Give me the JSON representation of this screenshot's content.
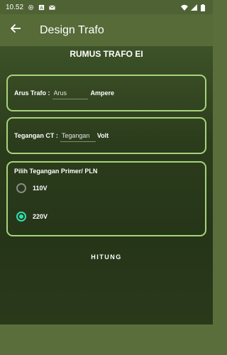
{
  "status_bar": {
    "time": "10.52",
    "icons": [
      "settings-icon",
      "sim-icon",
      "mail-icon",
      "wifi-icon",
      "signal-icon",
      "battery-icon"
    ]
  },
  "app_bar": {
    "title": "Design Trafo",
    "back_icon": "arrow-left-icon"
  },
  "heading": "RUMUS TRAFO EI",
  "arus_card": {
    "label": "Arus Trafo :",
    "placeholder": "Arus",
    "value": "",
    "unit": "Ampere"
  },
  "tegangan_card": {
    "label": "Tegangan CT :",
    "placeholder": "Tegangan",
    "value": "",
    "unit": "Volt"
  },
  "primer_card": {
    "title": "Pilih Tegangan Primer/ PLN",
    "options": [
      {
        "label": "110V",
        "checked": false
      },
      {
        "label": "220V",
        "checked": true
      }
    ]
  },
  "hitung_label": "HITUNG",
  "colors": {
    "app_bar": "#566b37",
    "card_border": "#a7d37a",
    "radio_accent": "#2ee0b4"
  }
}
